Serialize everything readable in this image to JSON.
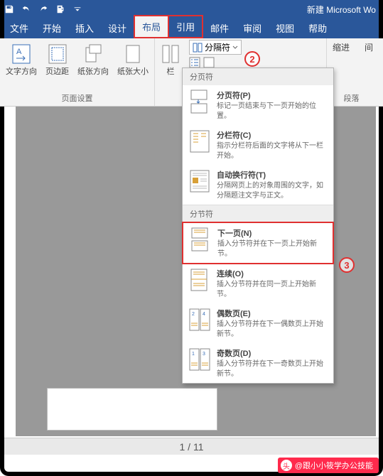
{
  "titlebar": {
    "app_title": "新建 Microsoft Wo"
  },
  "tabs": {
    "file": "文件",
    "home": "开始",
    "insert": "插入",
    "design": "设计",
    "layout": "布局",
    "references": "引用",
    "mailings": "邮件",
    "review": "审阅",
    "view": "视图",
    "help": "帮助"
  },
  "ribbon": {
    "text_direction": "文字方向",
    "margins": "页边距",
    "orientation": "纸张方向",
    "size": "纸张大小",
    "columns": "栏",
    "page_setup_group": "页面设置",
    "breaks": "分隔符",
    "indent_label": "缩进",
    "spacing_label": "间",
    "paragraph_group": "段落"
  },
  "menu": {
    "sec1": "分页符",
    "page_break_t": "分页符(P)",
    "page_break_d": "标记一页结束与下一页开始的位置。",
    "column_break_t": "分栏符(C)",
    "column_break_d": "指示分栏符后面的文字将从下一栏开始。",
    "text_wrap_t": "自动换行符(T)",
    "text_wrap_d": "分隔网页上的对象周围的文字，如分隔题注文字与正文。",
    "sec2": "分节符",
    "next_page_t": "下一页(N)",
    "next_page_d": "插入分节符并在下一页上开始新节。",
    "continuous_t": "连续(O)",
    "continuous_d": "插入分节符并在同一页上开始新节。",
    "even_page_t": "偶数页(E)",
    "even_page_d": "插入分节符并在下一偶数页上开始新节。",
    "odd_page_t": "奇数页(D)",
    "odd_page_d": "插入分节符并在下一奇数页上开始新节。"
  },
  "callouts": {
    "two": "2",
    "three": "3"
  },
  "status": {
    "page": "1  /  11"
  },
  "watermark": {
    "icon": "头",
    "text": "@跟小小筱学办公技能"
  }
}
